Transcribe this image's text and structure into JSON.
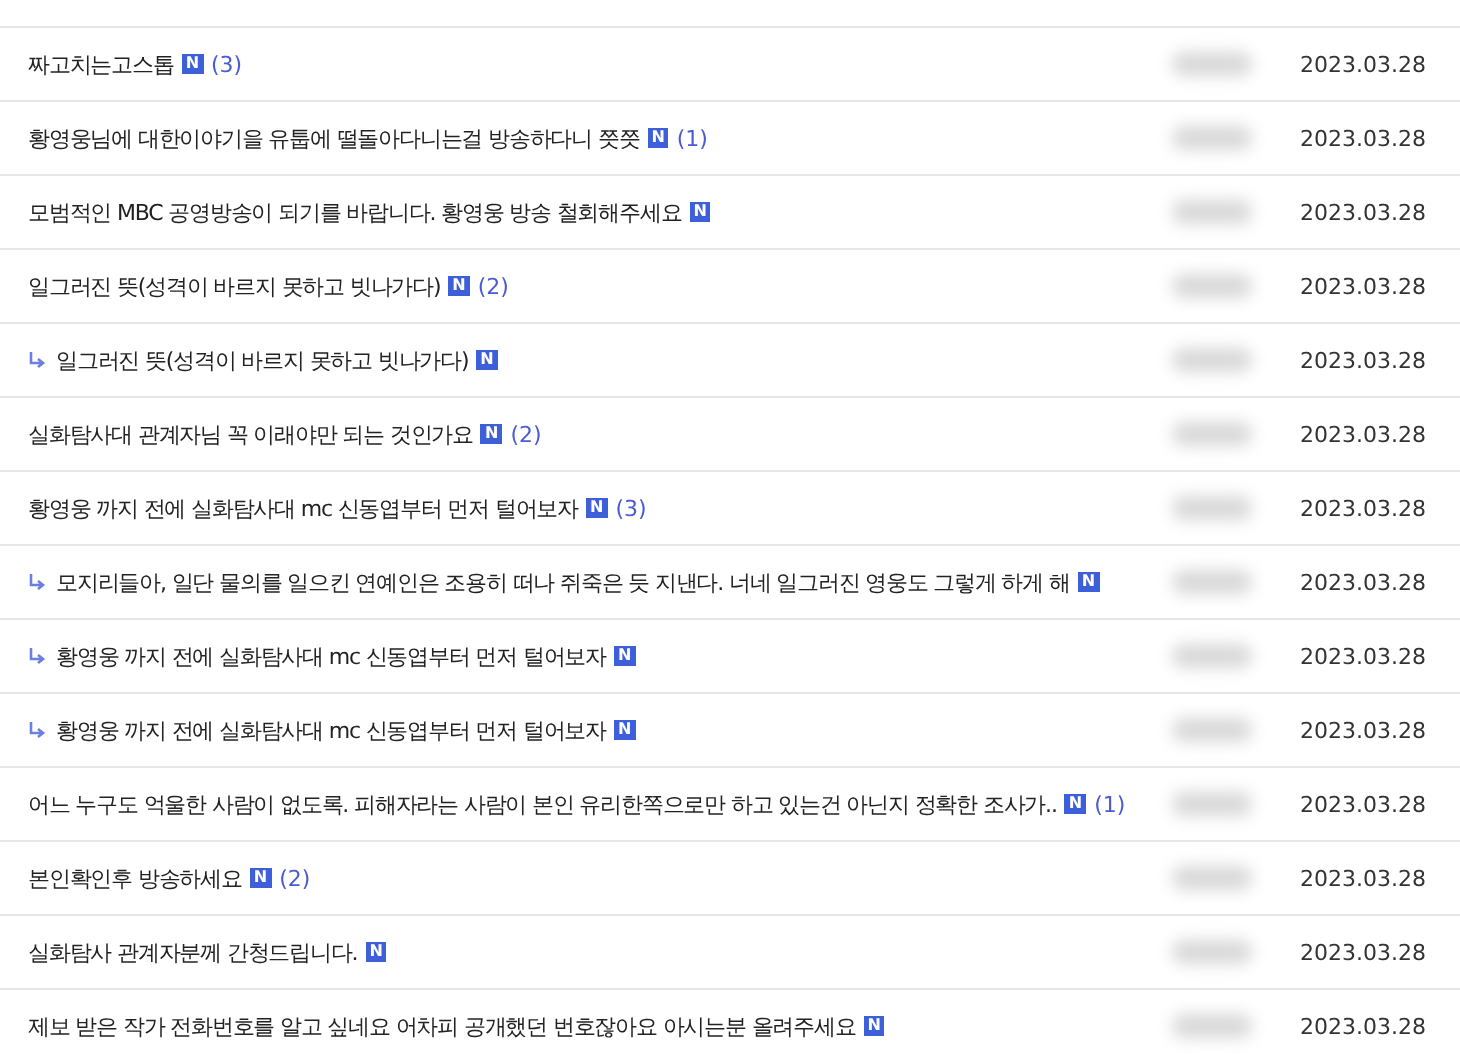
{
  "posts": [
    {
      "title": "짜고치는고스톱",
      "reply": false,
      "badge": "N",
      "comments": "(3)",
      "date": "2023.03.28"
    },
    {
      "title": "황영웅님에 대한이야기을 유툽에 떨돌아다니는걸 방송하다니 쯧쯧",
      "reply": false,
      "badge": "N",
      "comments": "(1)",
      "date": "2023.03.28"
    },
    {
      "title": "모범적인 MBC 공영방송이 되기를 바랍니다. 황영웅 방송 철회해주세요",
      "reply": false,
      "badge": "N",
      "date": "2023.03.28"
    },
    {
      "title": "일그러진 뜻(성격이 바르지 못하고 빗나가다)",
      "reply": false,
      "badge": "N",
      "comments": "(2)",
      "date": "2023.03.28"
    },
    {
      "title": "일그러진 뜻(성격이 바르지 못하고 빗나가다)",
      "reply": true,
      "badge": "N",
      "date": "2023.03.28"
    },
    {
      "title": "실화탐사대 관계자님 꼭 이래야만 되는 것인가요",
      "reply": false,
      "badge": "N",
      "comments": "(2)",
      "date": "2023.03.28"
    },
    {
      "title": "황영웅 까지 전에 실화탐사대 mc 신동엽부터 먼저 털어보자",
      "reply": false,
      "badge": "N",
      "comments": "(3)",
      "date": "2023.03.28"
    },
    {
      "title": "모지리들아, 일단 물의를 일으킨 연예인은 조용히 떠나 쥐죽은 듯 지낸다. 너네 일그러진 영웅도 그렇게 하게 해",
      "reply": true,
      "badge": "N",
      "date": "2023.03.28"
    },
    {
      "title": "황영웅 까지 전에 실화탐사대 mc 신동엽부터 먼저 털어보자",
      "reply": true,
      "badge": "N",
      "date": "2023.03.28"
    },
    {
      "title": "황영웅 까지 전에 실화탐사대 mc 신동엽부터 먼저 털어보자",
      "reply": true,
      "badge": "N",
      "date": "2023.03.28"
    },
    {
      "title": "어느 누구도 억울한 사람이 없도록. 피해자라는 사람이 본인 유리한쪽으로만 하고 있는건 아닌지 정확한 조사가..",
      "reply": false,
      "badge": "N",
      "comments": "(1)",
      "date": "2023.03.28"
    },
    {
      "title": "본인확인후 방송하세요",
      "reply": false,
      "badge": "N",
      "comments": "(2)",
      "date": "2023.03.28"
    },
    {
      "title": "실화탐사 관계자분께 간청드립니다.",
      "reply": false,
      "badge": "N",
      "date": "2023.03.28"
    },
    {
      "title": "제보 받은 작가 전화번호를 알고 싶네요 어차피 공개했던 번호잖아요 아시는분 올려주세요",
      "reply": false,
      "badge": "N",
      "date": "2023.03.28"
    }
  ]
}
